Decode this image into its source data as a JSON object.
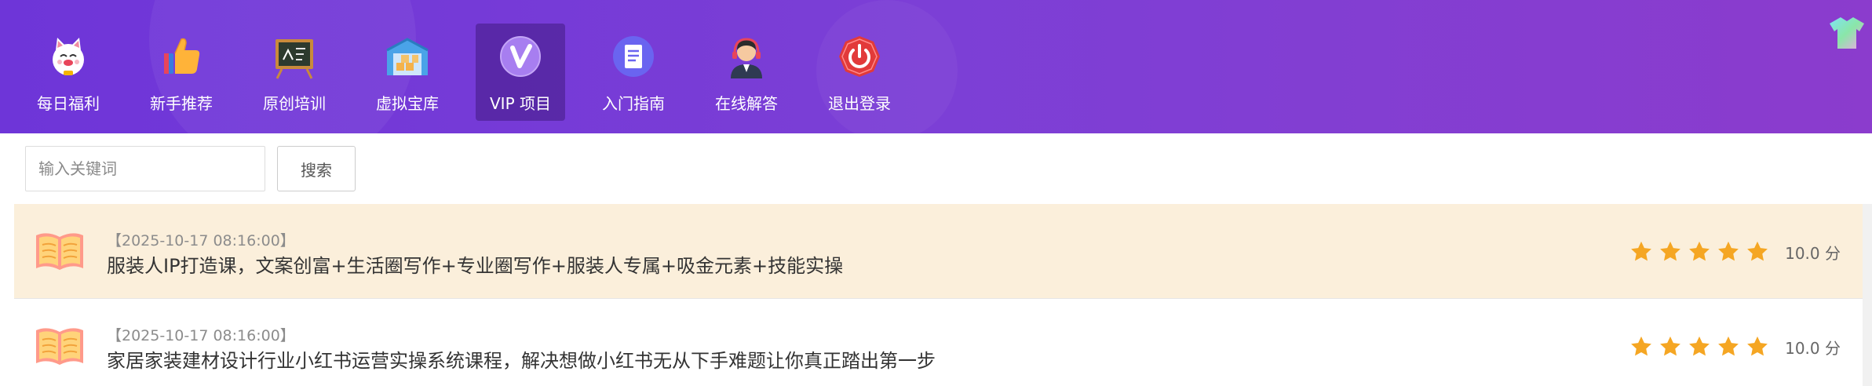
{
  "nav": {
    "items": [
      {
        "label": "每日福利",
        "icon": "lucky-cat-icon"
      },
      {
        "label": "新手推荐",
        "icon": "thumbs-up-icon"
      },
      {
        "label": "原创培训",
        "icon": "blackboard-icon"
      },
      {
        "label": "虚拟宝库",
        "icon": "warehouse-icon"
      },
      {
        "label": "VIP 项目",
        "icon": "vip-icon",
        "active": true
      },
      {
        "label": "入门指南",
        "icon": "document-icon"
      },
      {
        "label": "在线解答",
        "icon": "support-agent-icon"
      },
      {
        "label": "退出登录",
        "icon": "power-icon"
      }
    ],
    "skin_icon": "shirt-icon"
  },
  "search": {
    "placeholder": "输入关键词",
    "value": "",
    "button_label": "搜索"
  },
  "list": {
    "items": [
      {
        "date": "【2025-10-17 08:16:00】",
        "title": "服装人IP打造课，文案创富+生活圈写作+专业圈写作+服装人专属+吸金元素+技能实操",
        "stars": 5,
        "score": "10.0 分",
        "highlight": true
      },
      {
        "date": "【2025-10-17 08:16:00】",
        "title": "家居家装建材设计行业小红书运营实操系统课程，解决想做小红书无从下手难题让你真正踏出第一步",
        "stars": 5,
        "score": "10.0 分",
        "highlight": false
      }
    ]
  },
  "colors": {
    "header_start": "#6e35d8",
    "header_end": "#8b3ccd",
    "highlight_row": "#fbefdb",
    "star": "#f5a623"
  }
}
